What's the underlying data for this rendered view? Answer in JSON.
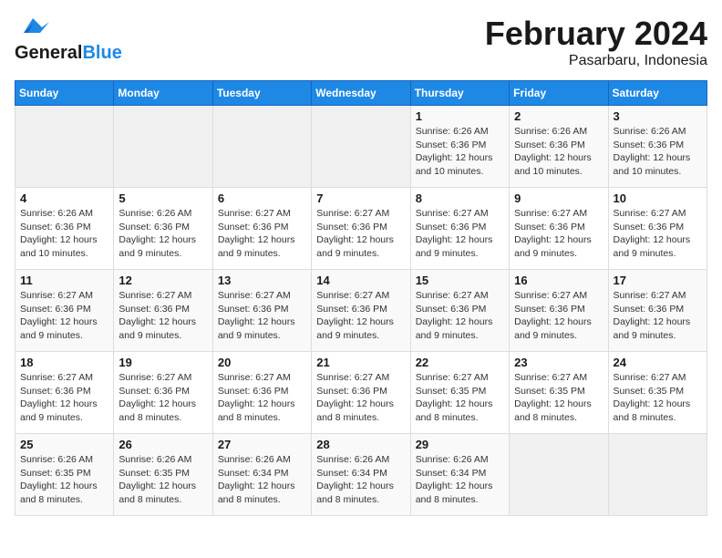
{
  "logo": {
    "text_general": "General",
    "text_blue": "Blue"
  },
  "title": "February 2024",
  "subtitle": "Pasarbaru, Indonesia",
  "days_of_week": [
    "Sunday",
    "Monday",
    "Tuesday",
    "Wednesday",
    "Thursday",
    "Friday",
    "Saturday"
  ],
  "weeks": [
    [
      {
        "num": "",
        "info": ""
      },
      {
        "num": "",
        "info": ""
      },
      {
        "num": "",
        "info": ""
      },
      {
        "num": "",
        "info": ""
      },
      {
        "num": "1",
        "info": "Sunrise: 6:26 AM\nSunset: 6:36 PM\nDaylight: 12 hours\nand 10 minutes."
      },
      {
        "num": "2",
        "info": "Sunrise: 6:26 AM\nSunset: 6:36 PM\nDaylight: 12 hours\nand 10 minutes."
      },
      {
        "num": "3",
        "info": "Sunrise: 6:26 AM\nSunset: 6:36 PM\nDaylight: 12 hours\nand 10 minutes."
      }
    ],
    [
      {
        "num": "4",
        "info": "Sunrise: 6:26 AM\nSunset: 6:36 PM\nDaylight: 12 hours\nand 10 minutes."
      },
      {
        "num": "5",
        "info": "Sunrise: 6:26 AM\nSunset: 6:36 PM\nDaylight: 12 hours\nand 9 minutes."
      },
      {
        "num": "6",
        "info": "Sunrise: 6:27 AM\nSunset: 6:36 PM\nDaylight: 12 hours\nand 9 minutes."
      },
      {
        "num": "7",
        "info": "Sunrise: 6:27 AM\nSunset: 6:36 PM\nDaylight: 12 hours\nand 9 minutes."
      },
      {
        "num": "8",
        "info": "Sunrise: 6:27 AM\nSunset: 6:36 PM\nDaylight: 12 hours\nand 9 minutes."
      },
      {
        "num": "9",
        "info": "Sunrise: 6:27 AM\nSunset: 6:36 PM\nDaylight: 12 hours\nand 9 minutes."
      },
      {
        "num": "10",
        "info": "Sunrise: 6:27 AM\nSunset: 6:36 PM\nDaylight: 12 hours\nand 9 minutes."
      }
    ],
    [
      {
        "num": "11",
        "info": "Sunrise: 6:27 AM\nSunset: 6:36 PM\nDaylight: 12 hours\nand 9 minutes."
      },
      {
        "num": "12",
        "info": "Sunrise: 6:27 AM\nSunset: 6:36 PM\nDaylight: 12 hours\nand 9 minutes."
      },
      {
        "num": "13",
        "info": "Sunrise: 6:27 AM\nSunset: 6:36 PM\nDaylight: 12 hours\nand 9 minutes."
      },
      {
        "num": "14",
        "info": "Sunrise: 6:27 AM\nSunset: 6:36 PM\nDaylight: 12 hours\nand 9 minutes."
      },
      {
        "num": "15",
        "info": "Sunrise: 6:27 AM\nSunset: 6:36 PM\nDaylight: 12 hours\nand 9 minutes."
      },
      {
        "num": "16",
        "info": "Sunrise: 6:27 AM\nSunset: 6:36 PM\nDaylight: 12 hours\nand 9 minutes."
      },
      {
        "num": "17",
        "info": "Sunrise: 6:27 AM\nSunset: 6:36 PM\nDaylight: 12 hours\nand 9 minutes."
      }
    ],
    [
      {
        "num": "18",
        "info": "Sunrise: 6:27 AM\nSunset: 6:36 PM\nDaylight: 12 hours\nand 9 minutes."
      },
      {
        "num": "19",
        "info": "Sunrise: 6:27 AM\nSunset: 6:36 PM\nDaylight: 12 hours\nand 8 minutes."
      },
      {
        "num": "20",
        "info": "Sunrise: 6:27 AM\nSunset: 6:36 PM\nDaylight: 12 hours\nand 8 minutes."
      },
      {
        "num": "21",
        "info": "Sunrise: 6:27 AM\nSunset: 6:36 PM\nDaylight: 12 hours\nand 8 minutes."
      },
      {
        "num": "22",
        "info": "Sunrise: 6:27 AM\nSunset: 6:35 PM\nDaylight: 12 hours\nand 8 minutes."
      },
      {
        "num": "23",
        "info": "Sunrise: 6:27 AM\nSunset: 6:35 PM\nDaylight: 12 hours\nand 8 minutes."
      },
      {
        "num": "24",
        "info": "Sunrise: 6:27 AM\nSunset: 6:35 PM\nDaylight: 12 hours\nand 8 minutes."
      }
    ],
    [
      {
        "num": "25",
        "info": "Sunrise: 6:26 AM\nSunset: 6:35 PM\nDaylight: 12 hours\nand 8 minutes."
      },
      {
        "num": "26",
        "info": "Sunrise: 6:26 AM\nSunset: 6:35 PM\nDaylight: 12 hours\nand 8 minutes."
      },
      {
        "num": "27",
        "info": "Sunrise: 6:26 AM\nSunset: 6:34 PM\nDaylight: 12 hours\nand 8 minutes."
      },
      {
        "num": "28",
        "info": "Sunrise: 6:26 AM\nSunset: 6:34 PM\nDaylight: 12 hours\nand 8 minutes."
      },
      {
        "num": "29",
        "info": "Sunrise: 6:26 AM\nSunset: 6:34 PM\nDaylight: 12 hours\nand 8 minutes."
      },
      {
        "num": "",
        "info": ""
      },
      {
        "num": "",
        "info": ""
      }
    ]
  ]
}
